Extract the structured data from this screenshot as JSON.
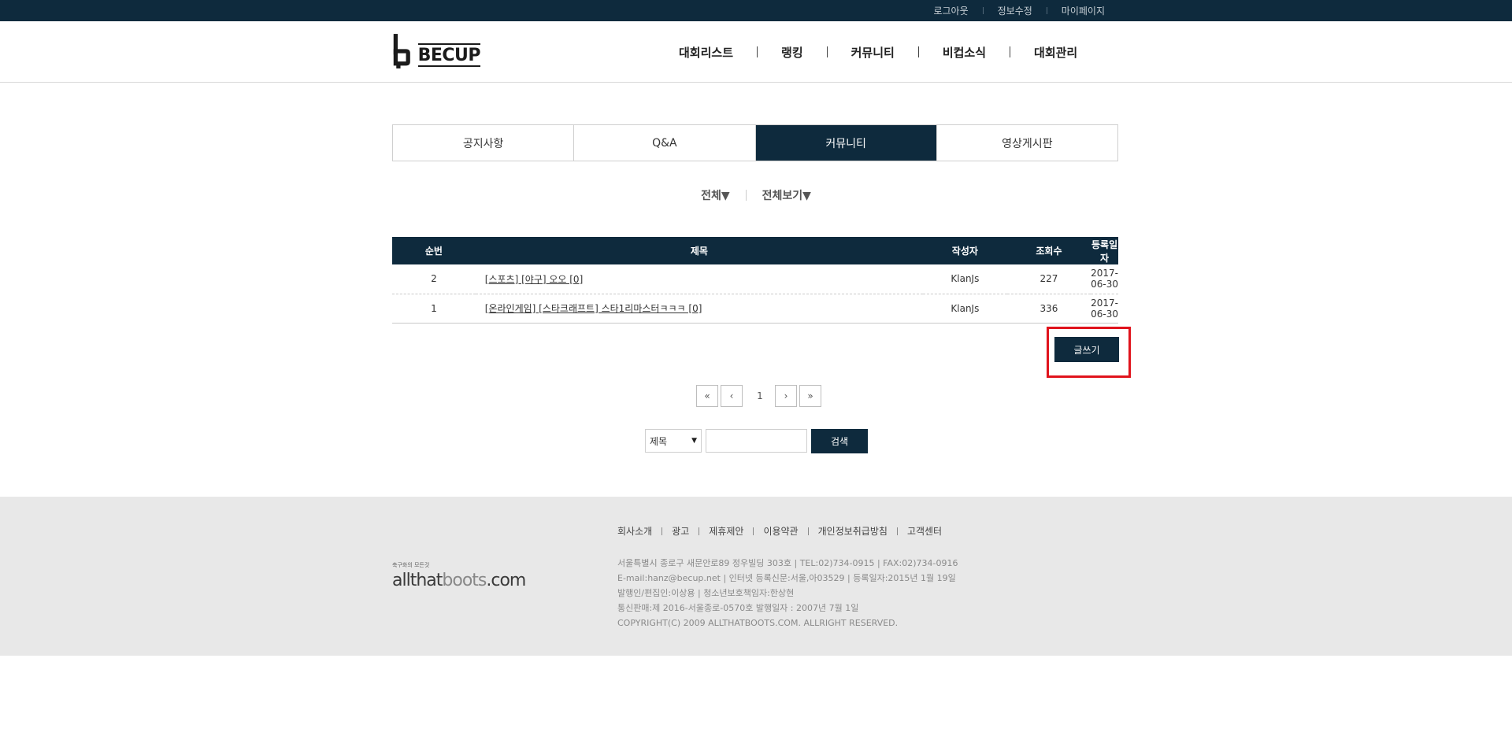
{
  "topbar": {
    "links": [
      "로그아웃",
      "정보수정",
      "마이페이지"
    ]
  },
  "header": {
    "logo_text": "BECUP",
    "nav": [
      "대회리스트",
      "랭킹",
      "커뮤니티",
      "비컵소식",
      "대회관리"
    ]
  },
  "tabs": [
    {
      "label": "공지사항",
      "active": false
    },
    {
      "label": "Q&A",
      "active": false
    },
    {
      "label": "커뮤니티",
      "active": true
    },
    {
      "label": "영상게시판",
      "active": false
    }
  ],
  "filters": {
    "category": "전체▼",
    "view": "전체보기▼"
  },
  "board": {
    "columns": [
      "순번",
      "제목",
      "작성자",
      "조회수",
      "등록일자"
    ],
    "rows": [
      {
        "no": "2",
        "title": "[스포츠] [야구] 오오 [0]",
        "author": "KlanJs",
        "views": "227",
        "date": "2017-06-30"
      },
      {
        "no": "1",
        "title": "[온라인게임] [스타크래프트] 스타1리마스터ㅋㅋㅋ [0]",
        "author": "KlanJs",
        "views": "336",
        "date": "2017-06-30"
      }
    ]
  },
  "write_button": "글쓰기",
  "pagination": {
    "first": "«",
    "prev": "‹",
    "current": "1",
    "next": "›",
    "last": "»"
  },
  "search": {
    "field_selected": "제목",
    "input_value": "",
    "button": "검색"
  },
  "footer": {
    "logo_small": "축구화의 모든것",
    "logo_bold": "allthat",
    "logo_thin": "boots",
    "logo_end": ".com",
    "links": [
      "회사소개",
      "광고",
      "제휴제안",
      "이용약관",
      "개인정보취급방침",
      "고객센터"
    ],
    "info": [
      "서울특별시 종로구 새문안로89 정우빌딩 303호 | TEL:02)734-0915 | FAX:02)734-0916",
      "E-mail:hanz@becup.net | 인터넷 등록신문:서울,아03529 | 등록일자:2015년 1월 19일",
      "발행인/편집인:이상용 | 청소년보호책임자:한상현",
      "통신판매:제 2016-서울종로-0570호 발행일자 : 2007년 7월 1일",
      "COPYRIGHT(C) 2009 ALLTHATBOOTS.COM. ALLRIGHT RESERVED."
    ]
  },
  "colors": {
    "navy": "#0e2a3d",
    "highlight": "#e0131c",
    "footer_bg": "#e8e8e8"
  }
}
